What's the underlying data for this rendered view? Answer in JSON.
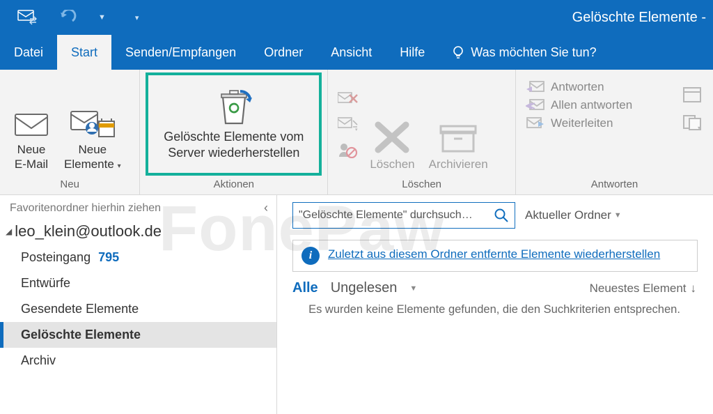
{
  "title": "Gelöschte Elemente - ",
  "tabs": {
    "datei": "Datei",
    "start": "Start",
    "senden": "Senden/Empfangen",
    "ordner": "Ordner",
    "ansicht": "Ansicht",
    "hilfe": "Hilfe",
    "tell_me": "Was möchten Sie tun?"
  },
  "ribbon": {
    "neu": {
      "group_label": "Neu",
      "new_mail_l1": "Neue",
      "new_mail_l2": "E-Mail",
      "new_items_l1": "Neue",
      "new_items_l2": "Elemente"
    },
    "aktionen": {
      "group_label": "Aktionen",
      "recover_l1": "Gelöschte Elemente vom",
      "recover_l2": "Server wiederherstellen"
    },
    "loeschen": {
      "group_label": "Löschen",
      "delete": "Löschen",
      "archive": "Archivieren"
    },
    "antworten": {
      "group_label": "Antworten",
      "reply": "Antworten",
      "reply_all": "Allen antworten",
      "forward": "Weiterleiten"
    }
  },
  "nav": {
    "fav_hint": "Favoritenordner hierhin ziehen",
    "account": "leo_klein@outlook.de",
    "folders": {
      "inbox": "Posteingang",
      "inbox_count": "795",
      "drafts": "Entwürfe",
      "sent": "Gesendete Elemente",
      "deleted": "Gelöschte Elemente",
      "archive": "Archiv"
    }
  },
  "content": {
    "search_placeholder": "\"Gelöschte Elemente\" durchsuch…",
    "scope": "Aktueller Ordner",
    "info_link": "Zuletzt aus diesem Ordner entfernte Elemente wiederherstellen",
    "filter_all": "Alle",
    "filter_unread": "Ungelesen",
    "sort_by": "Neuestes Element",
    "empty_msg": "Es wurden keine Elemente gefunden, die den Suchkriterien entsprechen."
  },
  "watermark": "FonePaw"
}
